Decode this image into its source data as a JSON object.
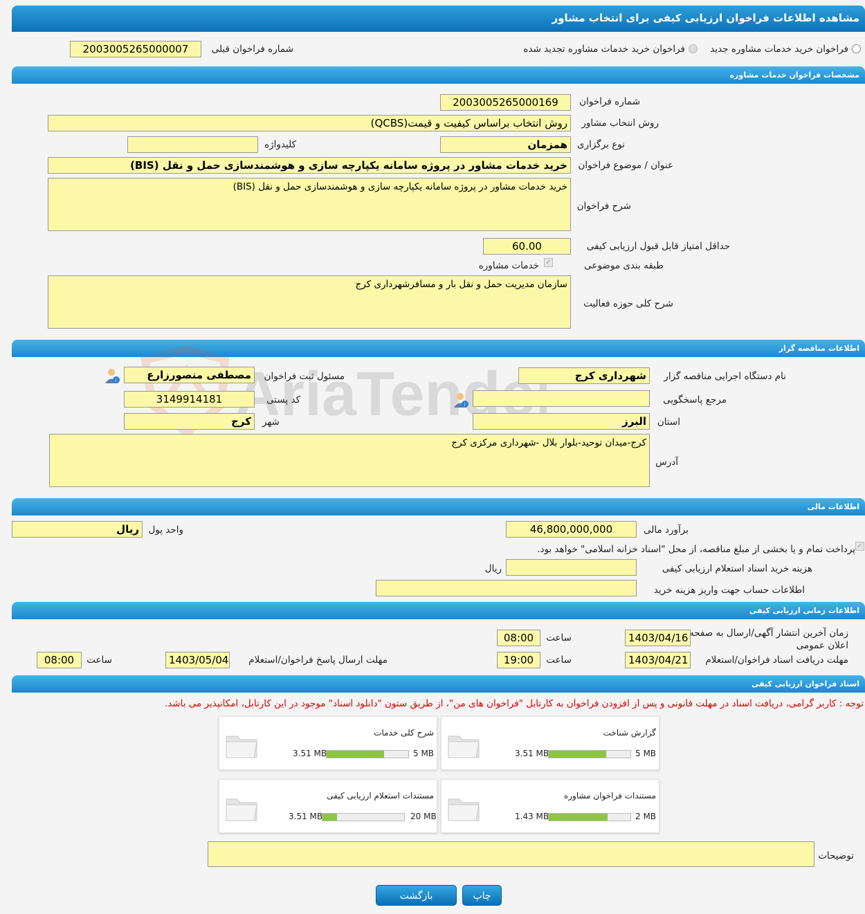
{
  "header": {
    "title": "مشاهده اطلاعات فراخوان ارزیابی کیفی برای انتخاب مشاور"
  },
  "top": {
    "radio_new": "فراخوان خرید خدمات مشاوره جدید",
    "radio_renewed": "فراخوان خرید خدمات مشاوره تجدید شده",
    "prev_label": "شماره فراخوان قبلی",
    "prev_value": "2003005265000007"
  },
  "sections": {
    "consult": "مشخصات فراخوان خدمات مشاوره",
    "tenderer": "اطلاعات مناقصه گزار",
    "finance": "اطلاعات مالی",
    "timing": "اطلاعات زمانی ارزیابی کیفی",
    "docs": "اسناد فراخوان ارزیابی کیفی"
  },
  "consult": {
    "number_label": "شماره فراخوان",
    "number": "2003005265000169",
    "method_label": "روش انتخاب مشاور",
    "method": "روش انتخاب براساس کیفیت و قیمت(QCBS)",
    "type_label": "نوع برگزاری",
    "type": "همزمان",
    "keyword_label": "کلیدواژه",
    "keyword": "",
    "subject_label": "عنوان / موضوع فراخوان",
    "subject": "خرید خدمات مشاور در پروژه سامانه یکپارچه سازی و هوشمندسازی حمل و نقل (BIS)",
    "desc_label": "شرح فراخوان",
    "desc": "خرید خدمات مشاور در پروژه سامانه یکپارچه سازی و هوشمندسازی حمل و نقل (BIS)",
    "minscore_label": "حداقل امتیاز قابل قبول ارزیابی کیفی",
    "minscore": "60.00",
    "category_label": "طبقه بندی موضوعی",
    "category": "خدمات مشاوره",
    "scope_label": "شرح کلی حوزه فعالیت",
    "scope": "سازمان مدیریت حمل و نقل بار و مسافرشهرداری کرج"
  },
  "tenderer": {
    "org_label": "نام دستگاه اجرایی مناقصه گزار",
    "org": "شهرداری کرج",
    "resp_label": "مسئول ثبت فراخوان",
    "resp": "مصطفی منصورزارع",
    "ref_label": "مرجع پاسخگویی",
    "ref": "",
    "postal_label": "کد پستی",
    "postal": "3149914181",
    "province_label": "استان",
    "province": "البرز",
    "city_label": "شهر",
    "city": "کرج",
    "address_label": "آدرس",
    "address": "کرج-میدان توحید-بلوار بلال -شهرداری مرکزی کرج"
  },
  "finance": {
    "estimate_label": "برآورد مالی",
    "estimate": "46,800,000,000",
    "currency_label": "واحد پول",
    "currency": "ریال",
    "treasury_text": "پرداخت تمام و یا بخشی از مبلغ مناقصه، از محل \"اسناد خزانه اسلامی\" خواهد بود.",
    "fee_label": "هزینه خرید اسناد استعلام ارزیابی کیفی",
    "fee": "",
    "fee_unit": "ریال",
    "account_label": "اطلاعات حساب جهت واریز هزینه خرید",
    "account": ""
  },
  "timing": {
    "publish_label": "زمان آخرین انتشار آگهی/ارسال به صفحه اعلان عمومی",
    "publish_date": "1403/04/16",
    "publish_time": "08:00",
    "receive_label": "مهلت دریافت اسناد فراخوان/استعلام",
    "receive_date": "1403/04/21",
    "receive_time": "19:00",
    "send_label": "مهلت ارسال پاسخ فراخوان/استعلام",
    "send_date": "1403/05/04",
    "send_time": "08:00",
    "time_label": "ساعت"
  },
  "docs": {
    "note": "توجه : کاربر گرامی، دریافت اسناد در مهلت قانونی و پس از افزودن فراخوان به کارتابل \"فراخوان های من\"، از طریق ستون \"دانلود اسناد\" موجود در این کارتابل، امکانپذیر می باشد.",
    "items": [
      {
        "title": "گزارش شناخت",
        "size": "3.51 MB",
        "max": "5 MB",
        "fill": 0.7
      },
      {
        "title": "شرح کلی خدمات",
        "size": "3.51 MB",
        "max": "5 MB",
        "fill": 0.7
      },
      {
        "title": "مستندات فراخوان مشاوره",
        "size": "1.43 MB",
        "max": "2 MB",
        "fill": 0.72
      },
      {
        "title": "مستندات استعلام ارزیابی کیفی",
        "size": "3.51 MB",
        "max": "20 MB",
        "fill": 0.18
      }
    ],
    "notes_label": "توضیحات",
    "notes": ""
  },
  "buttons": {
    "print": "چاپ",
    "back": "بازگشت"
  },
  "watermark": "AriaTender.neT",
  "colors": {
    "header": "#0d71b8",
    "field": "#fbf8a8",
    "progress": "#8dc63f",
    "note": "#dd0000"
  }
}
